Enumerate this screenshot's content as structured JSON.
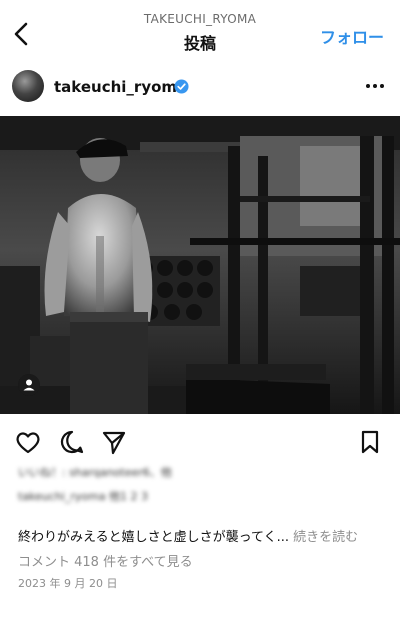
{
  "header": {
    "username": "TAKEUCHI_RYOMA",
    "title": "投稿",
    "follow_label": "フォロー"
  },
  "account": {
    "username": "takeuchi_ryoma",
    "verified": true
  },
  "post": {
    "likes_line": "いいね！: sharqanoteer6、他",
    "likes_line2": "takeuchi_ryoma 他1 2 3",
    "caption": "終わりがみえると嬉しさと虚しさが襲ってく...",
    "more_label": "続きを読む",
    "comments_link": "コメント 418 件をすべて見る",
    "date": "2023 年 9 月 20 日"
  },
  "icons": {
    "back": "chevron-left-icon",
    "verified": "verified-badge-icon",
    "more": "more-dots-icon",
    "tag": "user-tag-icon",
    "like": "heart-icon",
    "comment": "comment-icon",
    "share": "send-icon",
    "save": "bookmark-icon"
  },
  "colors": {
    "accent": "#2f8fe8",
    "verified": "#3897f0",
    "muted": "#8e8e8e"
  }
}
